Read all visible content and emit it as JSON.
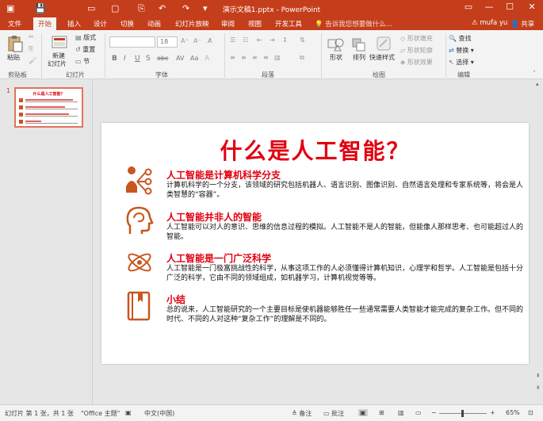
{
  "titlebar": {
    "title": "演示文稿1.pptx - PowerPoint",
    "min": "—",
    "max": "☐",
    "close": "✕",
    "restore": "▭"
  },
  "tabs": {
    "file": "文件",
    "home": "开始",
    "insert": "插入",
    "design": "设计",
    "transitions": "切换",
    "animations": "动画",
    "slideshow": "幻灯片放映",
    "review": "审阅",
    "view": "视图",
    "developer": "开发工具",
    "tellme": "告诉我您想要做什么...",
    "user": "mufa yu",
    "share": "共享"
  },
  "ribbon": {
    "paste": "粘贴",
    "clipboard": "剪贴板",
    "new_slide_1": "新建",
    "new_slide_2": "幻灯片",
    "layout": "版式",
    "reset": "重置",
    "section": "节",
    "slides": "幻灯片",
    "font_size": "18",
    "font": "字体",
    "paragraph": "段落",
    "shapes": "形状",
    "arrange": "排列",
    "quick_styles": "快速样式",
    "shape_fill": "形状填充",
    "shape_outline": "形状轮廓",
    "shape_effects": "形状效果",
    "drawing": "绘图",
    "find": "查找",
    "replace": "替换",
    "select": "选择",
    "editing": "编辑",
    "bold": "B",
    "italic": "I",
    "underline": "U",
    "strike": "S",
    "abc": "abc",
    "av": "AV",
    "aa": "Aa"
  },
  "thumbnail": {
    "number": "1",
    "title": "什么是人工智能？"
  },
  "slide": {
    "title": "什么是人工智能？",
    "sections": [
      {
        "heading": "人工智能是计算机科学分支",
        "body": "计算机科学的一个分支，该领域的研究包括机器人、语言识别、图像识别、自然语言处理和专家系统等，将会是人类智慧的“容器”。"
      },
      {
        "heading": "人工智能并非人的智能",
        "body": "人工智能可以对人的意识、思维的信息过程的模拟。人工智能不是人的智能，但能像人那样思考、也可能超过人的智能。"
      },
      {
        "heading": "人工智能是一门广泛科学",
        "body": "人工智能是一门极富挑战性的科学，从事这项工作的人必须懂得计算机知识，心理学和哲学。人工智能是包括十分广泛的科学，它由不同的领域组成，如机器学习，计算机视觉等等。"
      },
      {
        "heading": "小结",
        "body": "总的说来，人工智能研究的一个主要目标是使机器能够胜任一些通常需要人类智能才能完成的复杂工作。但不同的时代、不同的人对这种“复杂工作”的理解是不同的。"
      }
    ]
  },
  "statusbar": {
    "slide_info": "幻灯片 第 1 张，共 1 张",
    "theme": "\"Office 主题\"",
    "language": "中文(中国)",
    "notes": "备注",
    "comments": "批注",
    "zoom": "65%"
  },
  "colors": {
    "accent": "#c43e1c",
    "title_red": "#e1000f",
    "icon_orange": "#c8561f"
  }
}
